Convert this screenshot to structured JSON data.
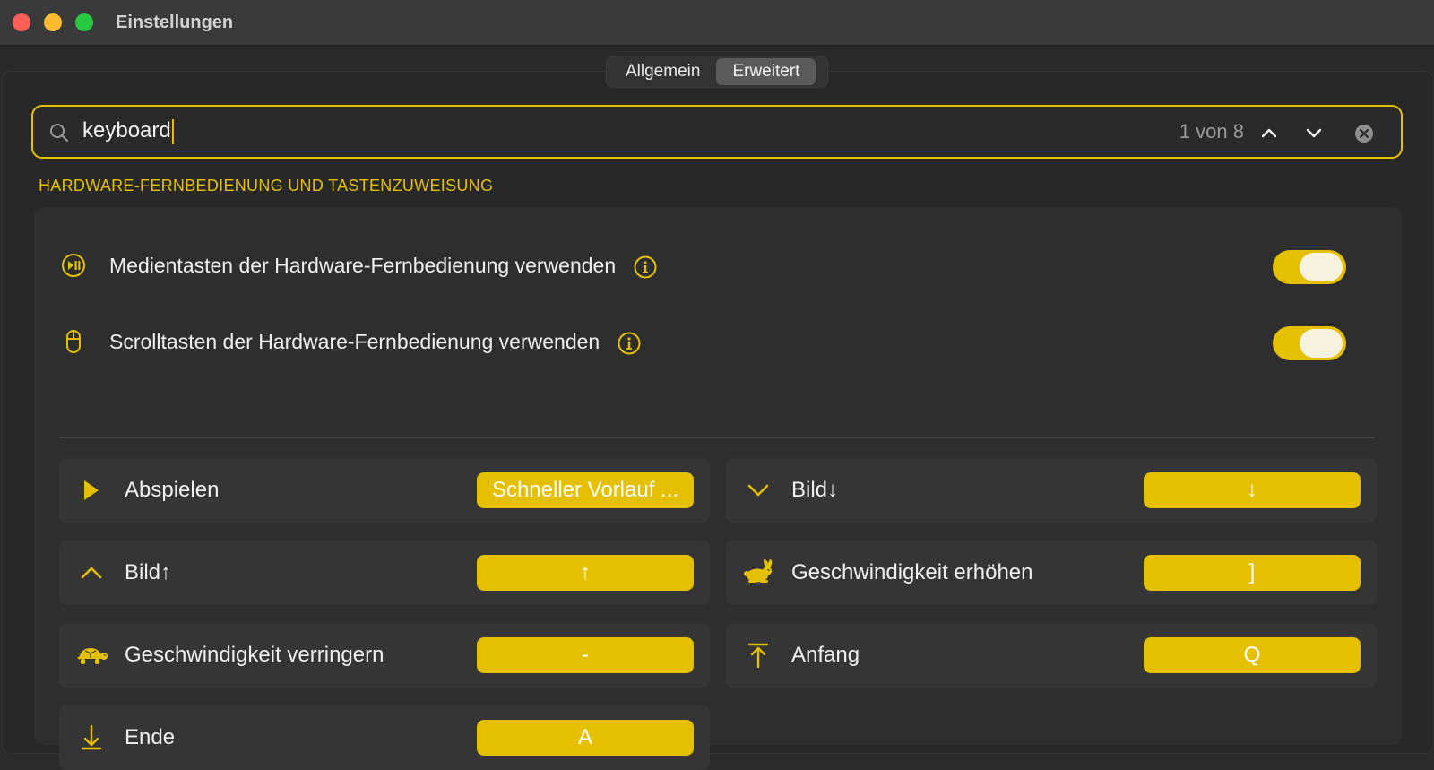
{
  "window": {
    "title": "Einstellungen"
  },
  "tabs": [
    {
      "label": "Allgemein",
      "active": false
    },
    {
      "label": "Erweitert",
      "active": true
    }
  ],
  "search": {
    "value": "keyboard",
    "match_count": "1 von 8"
  },
  "section": {
    "title": "HARDWARE-FERNBEDIENUNG UND TASTENZUWEISUNG"
  },
  "toggles": [
    {
      "label": "Medientasten der Hardware-Fernbedienung verwenden",
      "icon": "play-pause-circle-icon",
      "on": true
    },
    {
      "label": "Scrolltasten der Hardware-Fernbedienung verwenden",
      "icon": "mouse-icon",
      "on": true
    }
  ],
  "shortcuts": [
    {
      "label": "Abspielen",
      "key": "Schneller Vorlauf ...",
      "icon": "play-icon"
    },
    {
      "label": "Bild↓",
      "key": "↓",
      "icon": "chevron-down-icon"
    },
    {
      "label": "Bild↑",
      "key": "↑",
      "icon": "chevron-up-icon"
    },
    {
      "label": "Geschwindigkeit erhöhen",
      "key": "]",
      "icon": "rabbit-icon"
    },
    {
      "label": "Geschwindigkeit verringern",
      "key": "-",
      "icon": "turtle-icon"
    },
    {
      "label": "Anfang",
      "key": "Q",
      "icon": "arrow-to-top-icon"
    },
    {
      "label": "Ende",
      "key": "A",
      "icon": "arrow-to-bottom-icon"
    }
  ],
  "colors": {
    "accent": "#e4c000",
    "background": "#2a2a2a",
    "card": "#2e2e2e",
    "tile": "#353535"
  }
}
